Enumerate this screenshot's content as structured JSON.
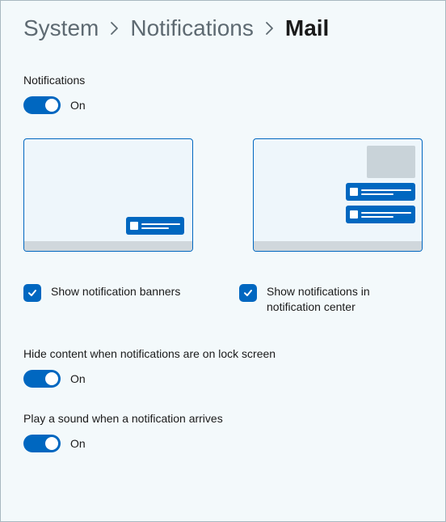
{
  "breadcrumb": {
    "system": "System",
    "notifications": "Notifications",
    "mail": "Mail"
  },
  "settings": {
    "notifications": {
      "label": "Notifications",
      "state": "On"
    },
    "banners": {
      "label": "Show notification banners"
    },
    "center": {
      "label": "Show notifications in notification center"
    },
    "hide": {
      "label": "Hide content when notifications are on lock screen",
      "state": "On"
    },
    "sound": {
      "label": "Play a sound when a notification arrives",
      "state": "On"
    }
  }
}
